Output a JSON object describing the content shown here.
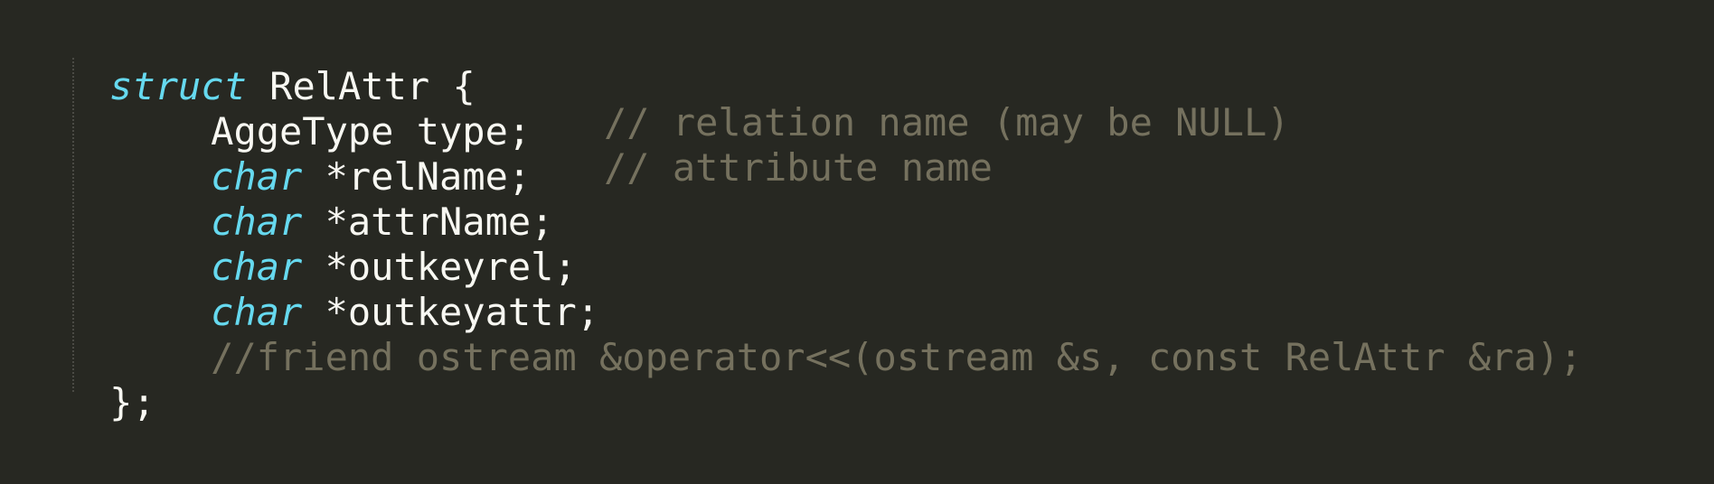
{
  "code": {
    "line1": {
      "keyword": "struct",
      "rest": " RelAttr {"
    },
    "line2": {
      "text": "AggeType type;"
    },
    "line3": {
      "type": "char",
      "rest": " *relName;",
      "comment": "// relation name (may be NULL)"
    },
    "line4": {
      "type": "char",
      "rest": " *attrName;",
      "comment": "// attribute name"
    },
    "line5": {
      "type": "char",
      "rest": " *outkeyrel;"
    },
    "line6": {
      "type": "char",
      "rest": " *outkeyattr;"
    },
    "line7": {
      "comment": "//friend ostream &operator<<(ostream &s, const RelAttr &ra);"
    },
    "line8": {
      "text": "};"
    }
  },
  "colors": {
    "background": "#272822",
    "foreground": "#f8f8f2",
    "keyword": "#66d9ef",
    "comment": "#75715e"
  }
}
